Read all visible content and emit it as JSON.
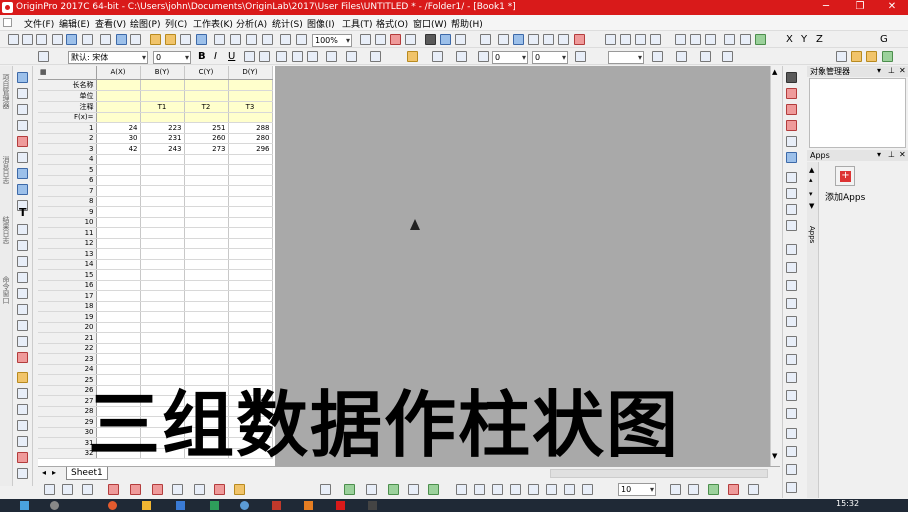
{
  "window": {
    "title": "OriginPro 2017C 64-bit - C:\\Users\\john\\Documents\\OriginLab\\2017\\User Files\\UNTITLED * - /Folder1/ - [Book1 *]",
    "minimize": "─",
    "restore": "❐",
    "close": "✕"
  },
  "menu": [
    "文件(F)",
    "编辑(E)",
    "查看(V)",
    "绘图(P)",
    "列(C)",
    "工作表(K)",
    "分析(A)",
    "统计(S)",
    "图像(I)",
    "工具(T)",
    "格式(O)",
    "窗口(W)",
    "帮助(H)"
  ],
  "toolbar": {
    "zoom": "100%",
    "font_name": "默认: 宋体",
    "font_size": "0",
    "bold": "B",
    "italic": "I",
    "underline": "U",
    "x_label": "X",
    "y_label": "Y",
    "z_label": "Z",
    "g_label": "G",
    "width_value": "0",
    "line_value": "0",
    "bottom_size": "10"
  },
  "sheet": {
    "columns": [
      "A(X)",
      "B(Y)",
      "C(Y)",
      "D(Y)"
    ],
    "meta_labels": [
      "长名称",
      "单位",
      "注释",
      "F(x)="
    ],
    "comments": [
      "",
      "T1",
      "T2",
      "T3"
    ],
    "row_numbers": [
      "1",
      "2",
      "3",
      "4",
      "5",
      "6",
      "7",
      "8",
      "9",
      "10",
      "11",
      "12",
      "13",
      "14",
      "15",
      "16",
      "17",
      "18",
      "19",
      "20",
      "21",
      "22",
      "23",
      "24",
      "25",
      "26",
      "27",
      "28",
      "29",
      "30",
      "31",
      "32"
    ],
    "data": [
      [
        "24",
        "223",
        "251",
        "288"
      ],
      [
        "30",
        "231",
        "260",
        "280"
      ],
      [
        "42",
        "243",
        "273",
        "296"
      ]
    ],
    "tab": "Sheet1"
  },
  "side_labels": [
    "项目管理器",
    "消息日志",
    "结果日志",
    "命令窗口"
  ],
  "panels": {
    "object_manager": "对象管理器",
    "apps": "Apps",
    "add_apps": "添加Apps",
    "apps_side_tab": "Apps"
  },
  "caption": "三组数据作柱状图",
  "taskbar": {
    "time": "15:32"
  },
  "colors": {
    "titlebar": "#d91a1a",
    "meta_fill": "#ffffcc",
    "workspace": "#a9a9a9"
  }
}
